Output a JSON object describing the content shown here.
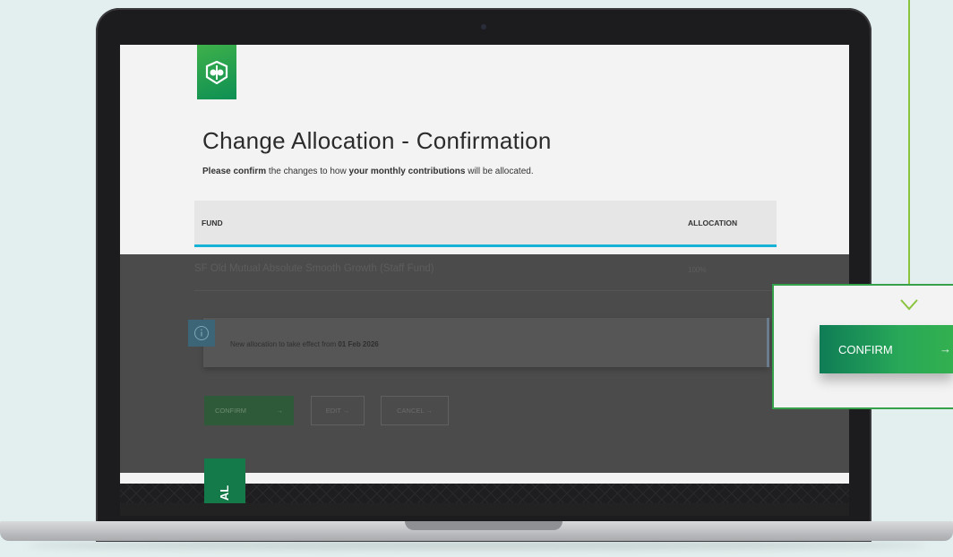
{
  "page": {
    "title": "Change Allocation - Confirmation",
    "subtitle_parts": {
      "bold1": "Please confirm",
      "text1": " the changes to how ",
      "bold2": "your monthly contributions",
      "text2": " will be allocated."
    }
  },
  "table": {
    "headers": {
      "fund": "FUND",
      "allocation": "ALLOCATION"
    },
    "rows": [
      {
        "fund": "SF Old Mutual Absolute Smooth Growth (Staff Fund)",
        "allocation": "100%"
      }
    ]
  },
  "notice": {
    "text": "New allocation to take effect from ",
    "date": "01 Feb 2026",
    "icon": "info-icon"
  },
  "actions": {
    "confirm": "CONFIRM",
    "edit": "EDIT →",
    "cancel": "CANCEL →",
    "arrow": "→"
  },
  "side_tab": {
    "label": "AL"
  },
  "callout": {
    "button_label": "CONFIRM",
    "button_arrow": "→"
  },
  "colors": {
    "brand_green": "#28a858",
    "accent_blue": "#17b3d6",
    "callout_line": "#8ac43f"
  }
}
